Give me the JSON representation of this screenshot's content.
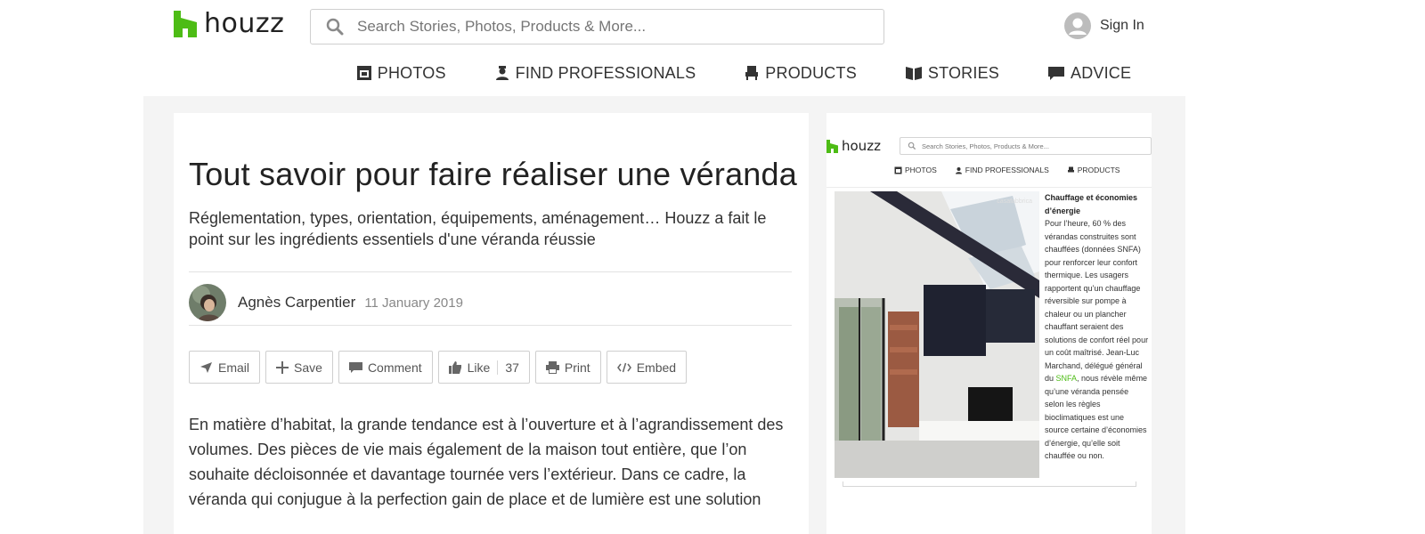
{
  "header": {
    "logo_text": "houzz",
    "search_placeholder": "Search Stories, Photos, Products & More...",
    "sign_in": "Sign In",
    "brand_color": "#4dbc15"
  },
  "nav": [
    {
      "label": "PHOTOS",
      "icon": "photos-icon"
    },
    {
      "label": "FIND PROFESSIONALS",
      "icon": "professional-icon"
    },
    {
      "label": "PRODUCTS",
      "icon": "chair-icon"
    },
    {
      "label": "STORIES",
      "icon": "book-icon"
    },
    {
      "label": "ADVICE",
      "icon": "chat-icon"
    }
  ],
  "article": {
    "title": "Tout savoir pour faire réaliser une véranda",
    "subtitle": "Réglementation, types, orientation, équipements, aménagement… Houzz a fait le point sur les ingrédients essentiels d'une véranda réussie",
    "author": "Agnès Carpentier",
    "date": "11 January 2019",
    "actions": {
      "email": "Email",
      "save": "Save",
      "comment": "Comment",
      "like": "Like",
      "like_count": "37",
      "print": "Print",
      "embed": "Embed"
    },
    "body": "En matière d’habitat, la grande tendance est à l’ouverture et à l’agrandissement des volumes. Des pièces de vie mais également de la maison tout entière, que l’on souhaite décloisonnée et davantage tournée vers l’extérieur. Dans ce cadre, la véranda qui conjugue à la perfection gain de place et de lumière est une solution"
  },
  "embed_preview": {
    "logo_text": "houzz",
    "search_placeholder": "Search Stories, Photos, Products & More...",
    "nav": [
      "PHOTOS",
      "FIND PROFESSIONALS",
      "PRODUCTS"
    ],
    "photo_credit": "casafabbrica",
    "heading": "Chauffage et économies d’énergie",
    "text_before_link": "Pour l’heure, 60 % des vérandas construites sont chauffées (données SNFA) pour renforcer leur confort thermique. Les usagers rapportent qu’un chauffage réversible sur pompe à chaleur ou un plancher chauffant seraient des solutions de confort réel pour un coût maîtrisé. Jean-Luc Marchand, délégué général du ",
    "link": "SNFA",
    "text_after_link": ", nous révèle même qu’une véranda pensée selon les règles bioclimatiques est une source certaine d’économies d’énergie, qu’elle soit chauffée ou non."
  }
}
